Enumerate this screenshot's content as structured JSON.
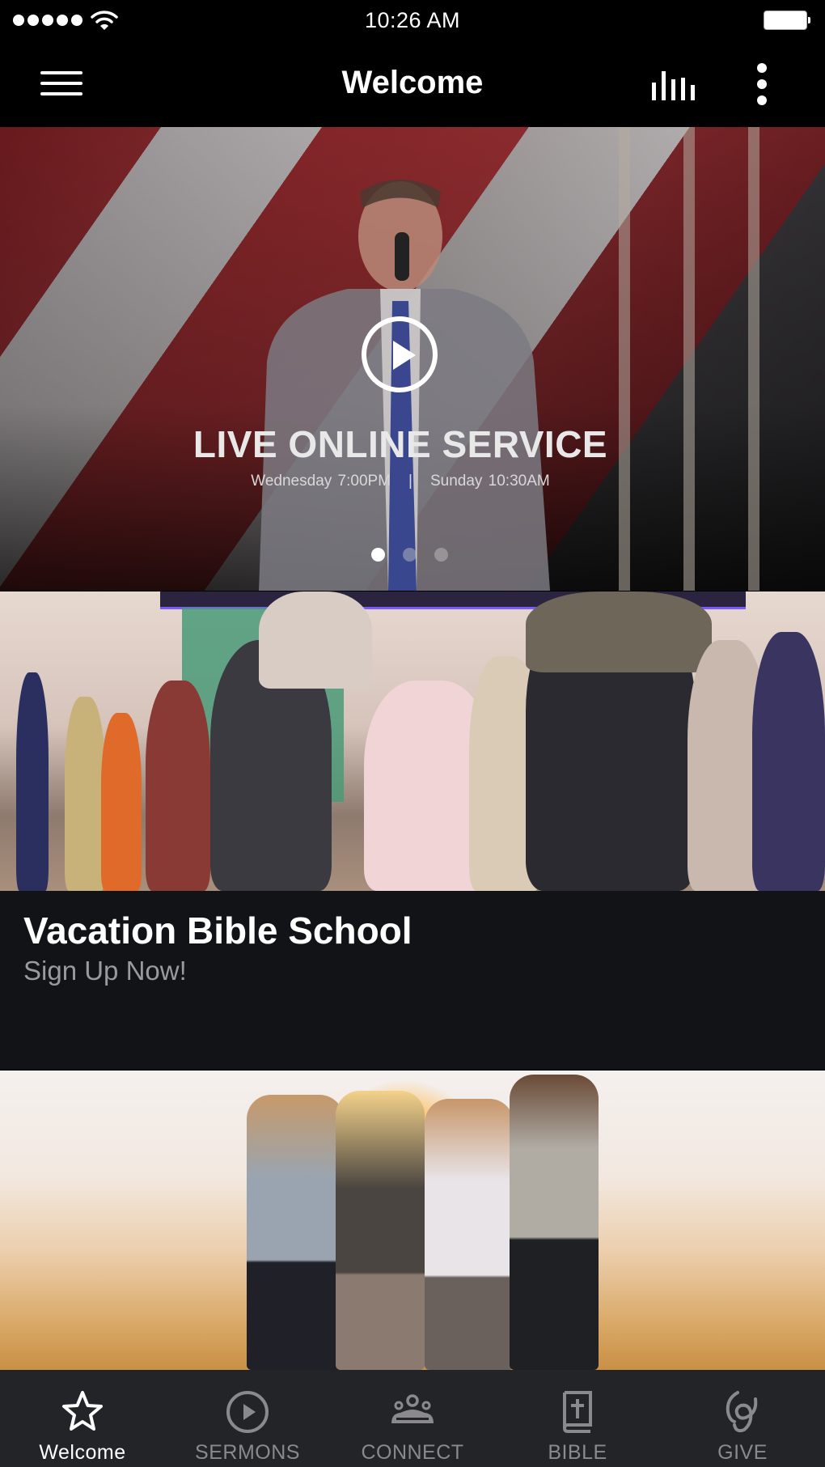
{
  "status_bar": {
    "time": "10:26 AM",
    "signal_icon": "cellular-signal-icon",
    "wifi_icon": "wifi-icon",
    "battery_icon": "battery-icon"
  },
  "nav_bar": {
    "title": "Welcome",
    "menu_icon": "hamburger-menu-icon",
    "audio_icon": "audio-bars-icon",
    "more_icon": "more-vertical-icon"
  },
  "hero": {
    "title": "LIVE ONLINE SERVICE",
    "times": [
      "Wednesday 7:00PM",
      "|",
      "Sunday 10:30AM"
    ],
    "play_icon": "play-circle-icon",
    "carousel": {
      "total": 3,
      "active_index": 0
    }
  },
  "cards": [
    {
      "title": "Vacation Bible School",
      "subtitle": "Sign Up Now!"
    }
  ],
  "tab_bar": {
    "accent_color": "#ffffff",
    "inactive_color": "#8a8a8c",
    "items": [
      {
        "label": "Welcome",
        "icon": "star-icon",
        "active": true
      },
      {
        "label": "SERMONS",
        "icon": "play-circle-icon",
        "active": false
      },
      {
        "label": "CONNECT",
        "icon": "group-icon",
        "active": false
      },
      {
        "label": "BIBLE",
        "icon": "bible-icon",
        "active": false
      },
      {
        "label": "GIVE",
        "icon": "give-hand-icon",
        "active": false
      }
    ]
  }
}
